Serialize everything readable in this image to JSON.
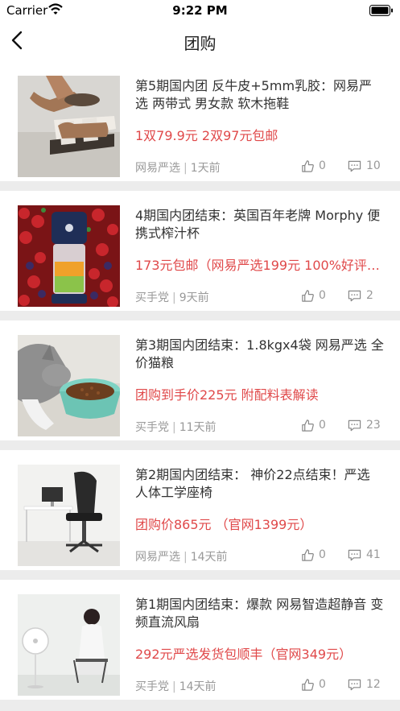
{
  "status_bar": {
    "carrier": "Carrier",
    "time": "9:22 PM"
  },
  "nav": {
    "title": "团购"
  },
  "items": [
    {
      "title": "第5期国内团 反牛皮+5mm乳胶：网易严选 两带式 男女款 软木拖鞋",
      "price": "1双79.9元 2双97元包邮",
      "source": "网易严选",
      "time": "1天前",
      "likes": "0",
      "comments": "10",
      "thumb": "sandals-photo"
    },
    {
      "title": "4期国内团结束：英国百年老牌 Morphy 便携式榨汁杯",
      "price": "173元包邮（网易严选199元 100%好评…",
      "source": "买手党",
      "time": "9天前",
      "likes": "0",
      "comments": "2",
      "thumb": "juicer-photo"
    },
    {
      "title": "第3期国内团结束：1.8kgx4袋 网易严选 全价猫粮",
      "price": "团购到手价225元 附配料表解读",
      "source": "买手党",
      "time": "11天前",
      "likes": "0",
      "comments": "23",
      "thumb": "cat-food-photo"
    },
    {
      "title": "第2期国内团结束： 神价22点结束！严选 人体工学座椅",
      "price": "团购价865元 （官网1399元）",
      "source": "网易严选",
      "time": "14天前",
      "likes": "0",
      "comments": "41",
      "thumb": "office-chair-photo"
    },
    {
      "title": "第1期国内团结束：爆款 网易智造超静音 变频直流风扇",
      "price": "292元严选发货包顺丰（官网349元）",
      "source": "买手党",
      "time": "14天前",
      "likes": "0",
      "comments": "12",
      "thumb": "fan-photo"
    }
  ],
  "colors": {
    "accent": "#e0494a",
    "meta": "#999999",
    "background": "#ececec"
  }
}
